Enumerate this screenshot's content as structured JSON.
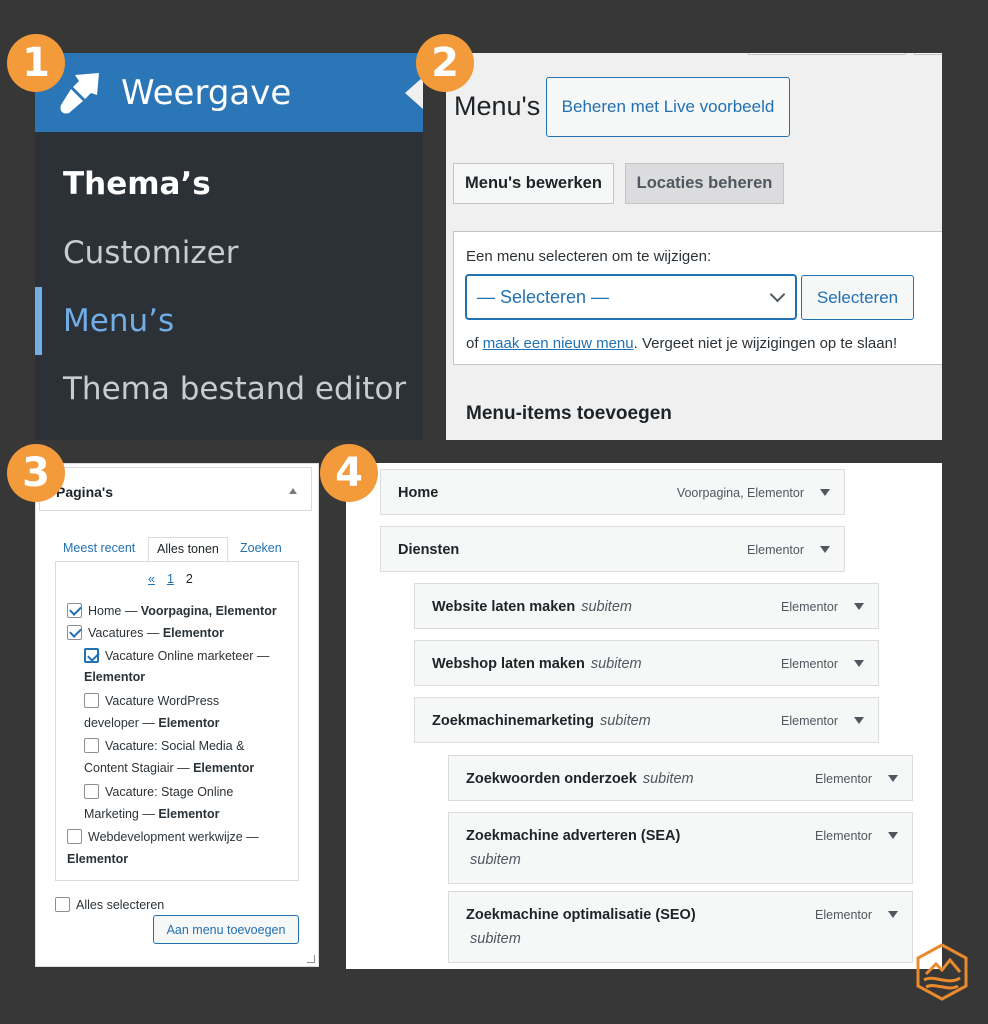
{
  "badges": [
    "1",
    "2",
    "3",
    "4"
  ],
  "panel1": {
    "title": "Weergave",
    "items": [
      "Thema’s",
      "Customizer",
      "Menu’s",
      "Thema bestand editor"
    ]
  },
  "panel2": {
    "title": "Menu's",
    "live_button": "Beheren met Live voorbeeld",
    "tabs": [
      "Menu's bewerken",
      "Locaties beheren"
    ],
    "select_label": "Een menu selecteren om te wijzigen:",
    "select_value": "— Selecteren —",
    "select_button": "Selecteren",
    "note_prefix": "of ",
    "note_link": "maak een nieuw menu",
    "note_suffix": ". Vergeet niet je wijzigingen op te slaan!",
    "add_items_title": "Menu-items toevoegen"
  },
  "panel3": {
    "title": "Pagina's",
    "tabs": [
      "Meest recent",
      "Alles tonen",
      "Zoeken"
    ],
    "pager": [
      "«",
      "1",
      "2"
    ],
    "items": [
      {
        "line1": "Home — ",
        "bold1": "Voorpagina, Elementor",
        "checked": true
      },
      {
        "line1": "Vacatures — ",
        "bold1": "Elementor",
        "checked": true
      },
      {
        "line1": "Vacature Online marketeer —",
        "bold2": "Elementor",
        "checked": true
      },
      {
        "line1": "Vacature WordPress",
        "line2": "developer — ",
        "bold2": "Elementor",
        "checked": false
      },
      {
        "line1": "Vacature: Social Media &",
        "line2": "Content Stagiair — ",
        "bold2": "Elementor",
        "checked": false
      },
      {
        "line1": "Vacature: Stage Online",
        "line2": "Marketing — ",
        "bold2": "Elementor",
        "checked": false
      },
      {
        "line1": "Webdevelopment werkwijze —",
        "bold2": "Elementor",
        "checked": false
      }
    ],
    "select_all": "Alles selecteren",
    "add_button": "Aan menu toevoegen"
  },
  "panel4": {
    "items": [
      {
        "name": "Home",
        "sub": "",
        "type": "Voorpagina, Elementor",
        "depth": 0
      },
      {
        "name": "Diensten",
        "sub": "",
        "type": "Elementor",
        "depth": 0
      },
      {
        "name": "Website laten maken",
        "sub": "subitem",
        "type": "Elementor",
        "depth": 1
      },
      {
        "name": "Webshop laten maken",
        "sub": "subitem",
        "type": "Elementor",
        "depth": 1
      },
      {
        "name": "Zoekmachinemarketing",
        "sub": "subitem",
        "type": "Elementor",
        "depth": 1
      },
      {
        "name": "Zoekwoorden onderzoek",
        "sub": "subitem",
        "type": "Elementor",
        "depth": 2
      },
      {
        "name": "Zoekmachine adverteren (SEA)",
        "sub": "subitem",
        "type": "Elementor",
        "depth": 2
      },
      {
        "name": "Zoekmachine optimalisatie (SEO)",
        "sub": "subitem",
        "type": "Elementor",
        "depth": 2
      }
    ]
  },
  "colors": {
    "background": "#373737",
    "badge": "#f39a3b",
    "wp_blue": "#2b76b7",
    "link_blue": "#2271b1",
    "admin_sidebar": "#2c3138",
    "active_menu": "#72aee6"
  }
}
